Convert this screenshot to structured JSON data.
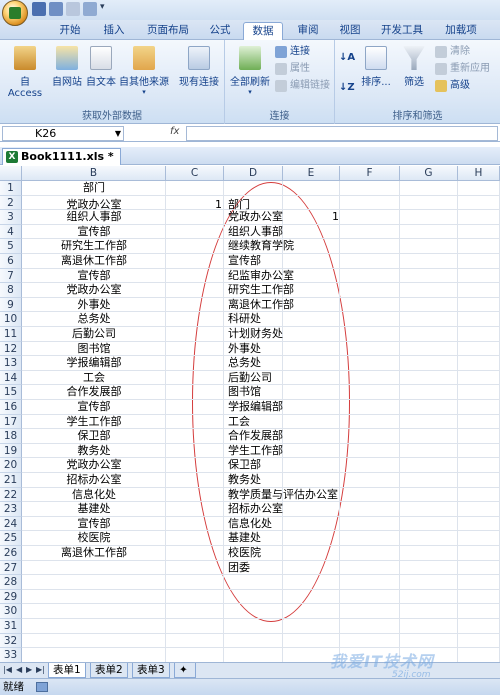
{
  "app": {
    "file_name": "Book1111.xls *",
    "ribbon_tabs": [
      "开始",
      "插入",
      "页面布局",
      "公式",
      "数据",
      "审阅",
      "视图",
      "开发工具",
      "加载项"
    ],
    "active_tab": "数据"
  },
  "ribbon": {
    "external": {
      "access": "自 Access",
      "web": "自网站",
      "text": "自文本",
      "other": "自其他来源",
      "existing": "现有连接",
      "group_label": "获取外部数据"
    },
    "connections": {
      "refresh_all": "全部刷新",
      "connections": "连接",
      "properties": "属性",
      "edit_links": "编辑链接",
      "group_label": "连接"
    },
    "sort_filter": {
      "sort": "排序...",
      "filter": "筛选",
      "clear": "清除",
      "reapply": "重新应用",
      "advanced": "高级",
      "group_label": "排序和筛选"
    }
  },
  "formula_bar": {
    "name_box": "K26",
    "fx": "fx",
    "formula": ""
  },
  "grid": {
    "columns": [
      "B",
      "C",
      "D",
      "E",
      "F",
      "G",
      "H"
    ],
    "rows": [
      {
        "n": "1",
        "B": "部门",
        "C": "",
        "D": "",
        "E": ""
      },
      {
        "n": "2",
        "B": "党政办公室",
        "C": "1",
        "D": "部门",
        "E": ""
      },
      {
        "n": "3",
        "B": "组织人事部",
        "C": "",
        "D": "党政办公室",
        "E": "1"
      },
      {
        "n": "4",
        "B": "宣传部",
        "C": "",
        "D": "组织人事部",
        "E": ""
      },
      {
        "n": "5",
        "B": "研究生工作部",
        "C": "",
        "D": "继续教育学院",
        "E": ""
      },
      {
        "n": "6",
        "B": "离退休工作部",
        "C": "",
        "D": "宣传部",
        "E": ""
      },
      {
        "n": "7",
        "B": "宣传部",
        "C": "",
        "D": "纪监审办公室",
        "E": ""
      },
      {
        "n": "8",
        "B": "党政办公室",
        "C": "",
        "D": "研究生工作部",
        "E": ""
      },
      {
        "n": "9",
        "B": "外事处",
        "C": "",
        "D": "离退休工作部",
        "E": ""
      },
      {
        "n": "10",
        "B": "总务处",
        "C": "",
        "D": "科研处",
        "E": ""
      },
      {
        "n": "11",
        "B": "后勤公司",
        "C": "",
        "D": "计划财务处",
        "E": ""
      },
      {
        "n": "12",
        "B": "图书馆",
        "C": "",
        "D": "外事处",
        "E": ""
      },
      {
        "n": "13",
        "B": "学报编辑部",
        "C": "",
        "D": "总务处",
        "E": ""
      },
      {
        "n": "14",
        "B": "工会",
        "C": "",
        "D": "后勤公司",
        "E": ""
      },
      {
        "n": "15",
        "B": "合作发展部",
        "C": "",
        "D": "图书馆",
        "E": ""
      },
      {
        "n": "16",
        "B": "宣传部",
        "C": "",
        "D": "学报编辑部",
        "E": ""
      },
      {
        "n": "17",
        "B": "学生工作部",
        "C": "",
        "D": "工会",
        "E": ""
      },
      {
        "n": "18",
        "B": "保卫部",
        "C": "",
        "D": "合作发展部",
        "E": ""
      },
      {
        "n": "19",
        "B": "教务处",
        "C": "",
        "D": "学生工作部",
        "E": ""
      },
      {
        "n": "20",
        "B": "党政办公室",
        "C": "",
        "D": "保卫部",
        "E": ""
      },
      {
        "n": "21",
        "B": "招标办公室",
        "C": "",
        "D": "教务处",
        "E": ""
      },
      {
        "n": "22",
        "B": "信息化处",
        "C": "",
        "D": "教学质量与评估办公室",
        "E": ""
      },
      {
        "n": "23",
        "B": "基建处",
        "C": "",
        "D": "招标办公室",
        "E": ""
      },
      {
        "n": "24",
        "B": "宣传部",
        "C": "",
        "D": "信息化处",
        "E": ""
      },
      {
        "n": "25",
        "B": "校医院",
        "C": "",
        "D": "基建处",
        "E": ""
      },
      {
        "n": "26",
        "B": "离退休工作部",
        "C": "",
        "D": "校医院",
        "E": ""
      },
      {
        "n": "27",
        "B": "",
        "C": "",
        "D": "团委",
        "E": ""
      },
      {
        "n": "28",
        "B": "",
        "C": "",
        "D": "",
        "E": ""
      },
      {
        "n": "29",
        "B": "",
        "C": "",
        "D": "",
        "E": ""
      },
      {
        "n": "30",
        "B": "",
        "C": "",
        "D": "",
        "E": ""
      },
      {
        "n": "31",
        "B": "",
        "C": "",
        "D": "",
        "E": ""
      },
      {
        "n": "32",
        "B": "",
        "C": "",
        "D": "",
        "E": ""
      },
      {
        "n": "33",
        "B": "",
        "C": "",
        "D": "",
        "E": ""
      }
    ]
  },
  "sheets": [
    "表单1",
    "表单2",
    "表单3"
  ],
  "status": {
    "ready": "就绪"
  },
  "watermark": {
    "main": "我爱IT技术网",
    "sub": "52ij.com"
  },
  "colors": {
    "annotation_oval": "#d43c3c",
    "ribbon_text": "#15428b"
  }
}
